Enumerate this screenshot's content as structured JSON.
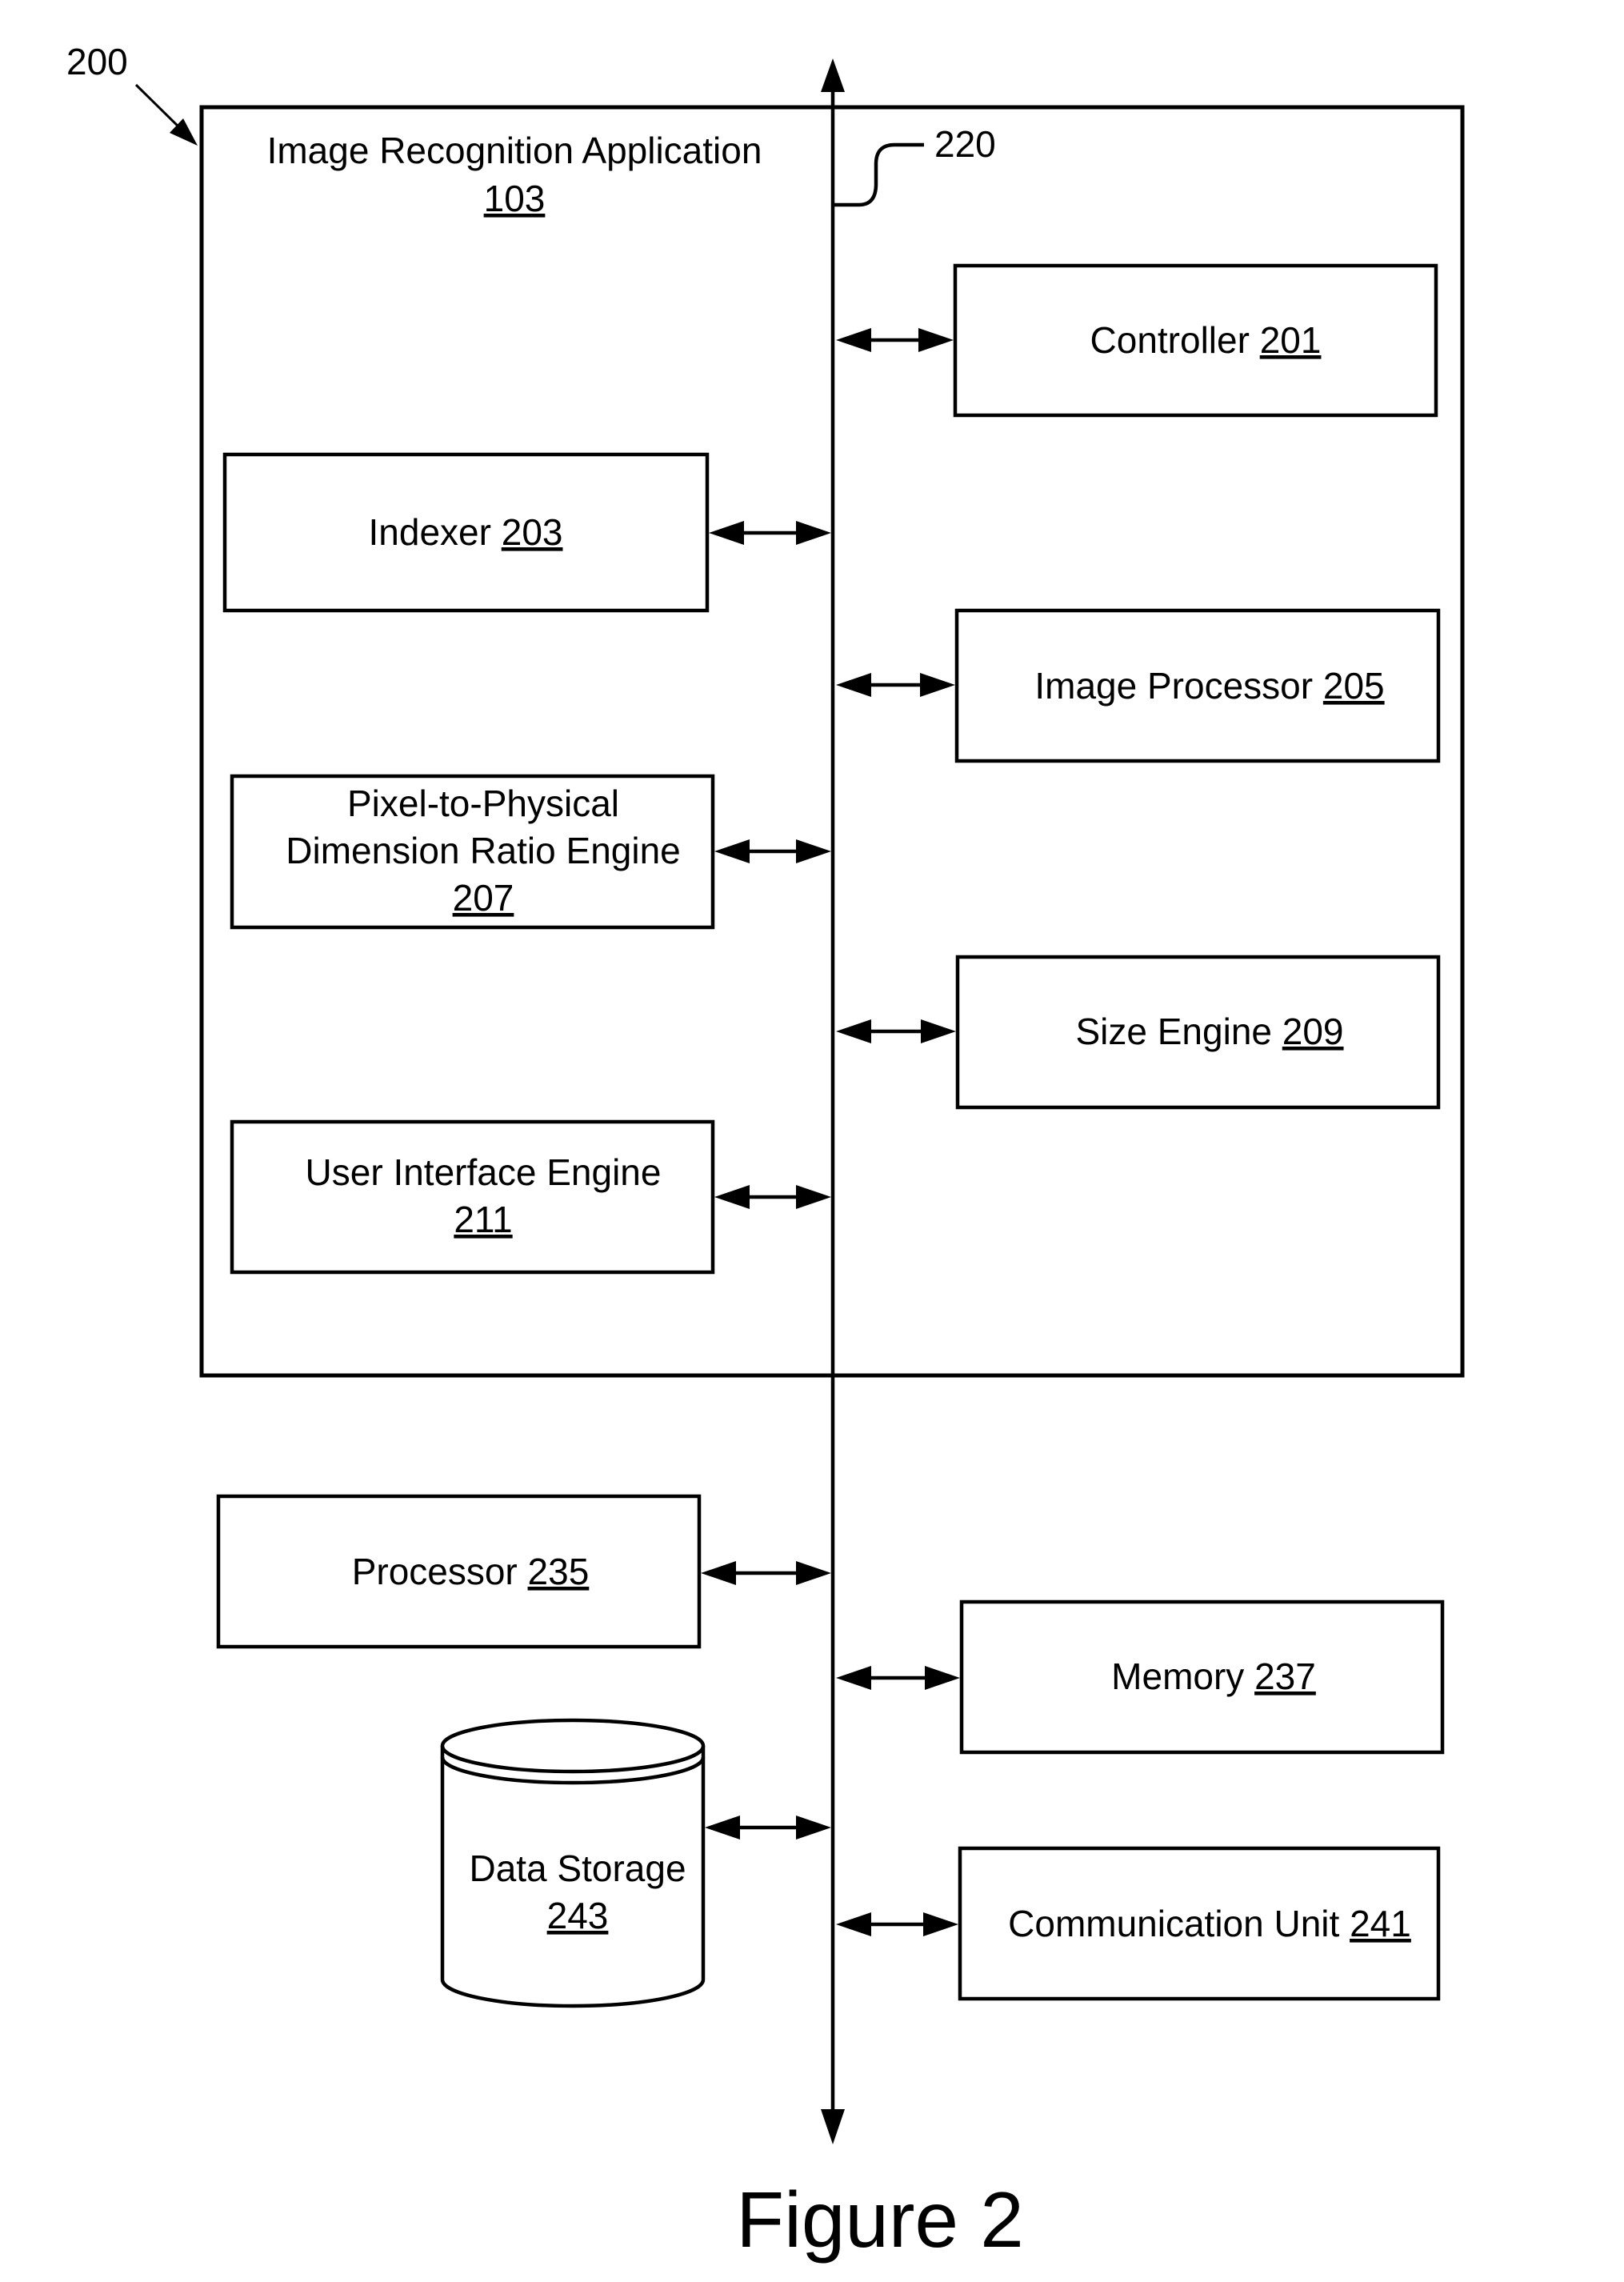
{
  "figure_ref": "200",
  "bus_ref": "220",
  "figure_caption": "Figure 2",
  "application": {
    "title": "Image Recognition Application",
    "ref": "103"
  },
  "components": {
    "controller": {
      "name": "Controller",
      "ref": "201"
    },
    "indexer": {
      "name": "Indexer",
      "ref": "203"
    },
    "image_processor": {
      "name": "Image Processor",
      "ref": "205"
    },
    "pixel_ratio_engine": {
      "name_line1": "Pixel-to-Physical",
      "name_line2": "Dimension Ratio Engine",
      "ref": "207"
    },
    "size_engine": {
      "name": "Size Engine",
      "ref": "209"
    },
    "ui_engine": {
      "name": "User Interface Engine",
      "ref": "211"
    },
    "processor": {
      "name": "Processor",
      "ref": "235"
    },
    "memory": {
      "name": "Memory",
      "ref": "237"
    },
    "data_storage": {
      "name": "Data Storage",
      "ref": "243"
    },
    "communication_unit": {
      "name": "Communication Unit",
      "ref": "241"
    }
  },
  "colors": {
    "stroke": "#000000",
    "background": "#ffffff"
  }
}
